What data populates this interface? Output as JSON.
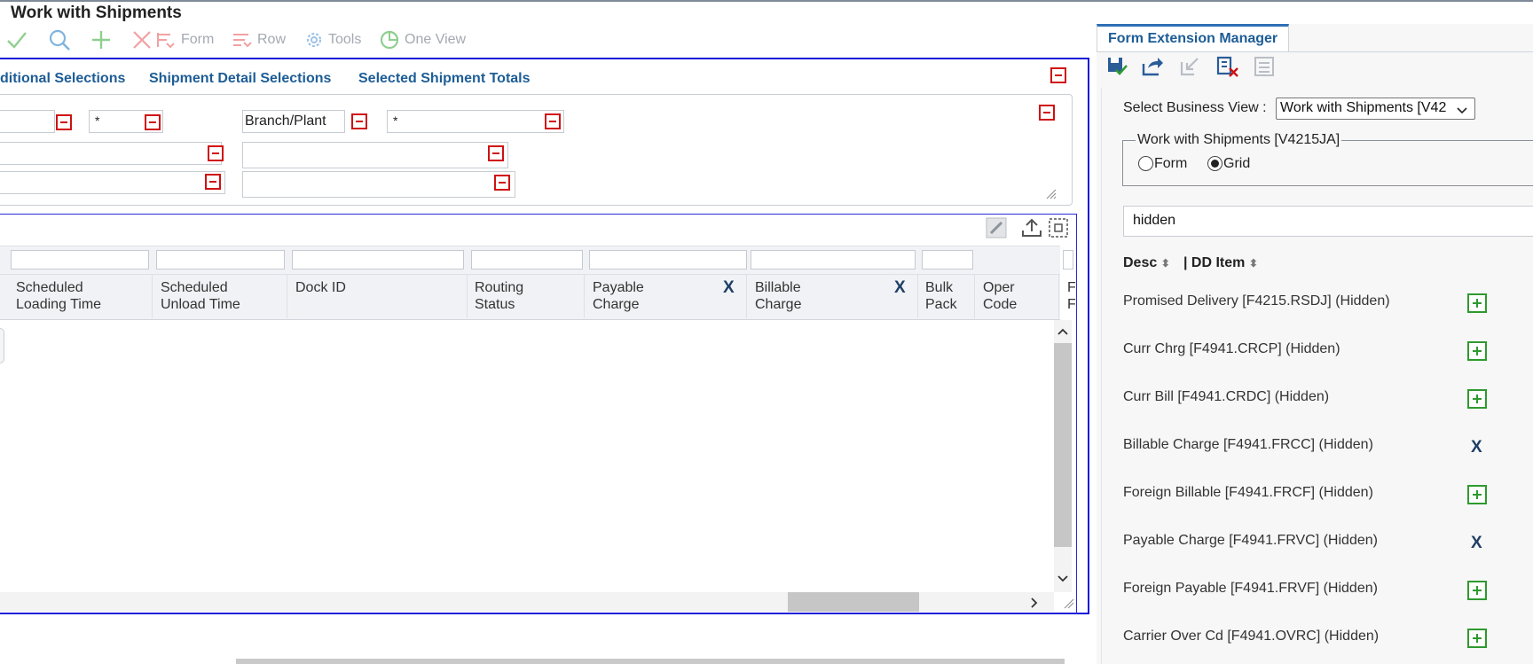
{
  "window": {
    "title": "Work with Shipments"
  },
  "toolbar": {
    "form_label": "Form",
    "row_label": "Row",
    "tools_label": "Tools",
    "one_view_label": "One View"
  },
  "tabs": [
    "ditional Selections",
    "Shipment Detail Selections",
    "Selected Shipment Totals"
  ],
  "qbe": {
    "field1_value": "*",
    "branch_plant_label": "Branch/Plant",
    "branch_plant_value": "*"
  },
  "grid": {
    "columns": [
      {
        "label1": "Scheduled",
        "label2": "Loading Time"
      },
      {
        "label1": "Scheduled",
        "label2": "Unload Time"
      },
      {
        "label1": "Dock ID",
        "label2": ""
      },
      {
        "label1": "Routing",
        "label2": "Status"
      },
      {
        "label1": "Payable",
        "label2": "Charge"
      },
      {
        "label1": "Billable",
        "label2": "Charge"
      },
      {
        "label1": "Bulk",
        "label2": "Pack"
      },
      {
        "label1": "Oper",
        "label2": "Code"
      },
      {
        "label1": "F",
        "label2": "F"
      }
    ],
    "hide_marker": "X"
  },
  "fem": {
    "tab_label": "Form Extension Manager",
    "select_bv_label": "Select Business View :",
    "select_bv_value": "Work with Shipments [V42",
    "group_legend": "Work with Shipments [V4215JA]",
    "radio_form": "Form",
    "radio_grid": "Grid",
    "search_value": "hidden",
    "col_desc": "Desc",
    "col_dd": "| DD Item",
    "items": [
      {
        "label": "Promised Delivery [F4215.RSDJ] (Hidden)",
        "action": "add"
      },
      {
        "label": "Curr Chrg [F4941.CRCP] (Hidden)",
        "action": "add"
      },
      {
        "label": "Curr Bill [F4941.CRDC] (Hidden)",
        "action": "add"
      },
      {
        "label": "Billable Charge [F4941.FRCC] (Hidden)",
        "action": "remove"
      },
      {
        "label": "Foreign Billable [F4941.FRCF] (Hidden)",
        "action": "add"
      },
      {
        "label": "Payable Charge [F4941.FRVC] (Hidden)",
        "action": "remove"
      },
      {
        "label": "Foreign Payable [F4941.FRVF] (Hidden)",
        "action": "add"
      },
      {
        "label": "Carrier Over Cd [F4941.OVRC] (Hidden)",
        "action": "add"
      }
    ],
    "remove_marker": "X"
  },
  "colors": {
    "accent": "#1d5d96",
    "border_focus": "#1414d9",
    "add_green": "#2e9a2e",
    "remove_red": "#d01010"
  }
}
